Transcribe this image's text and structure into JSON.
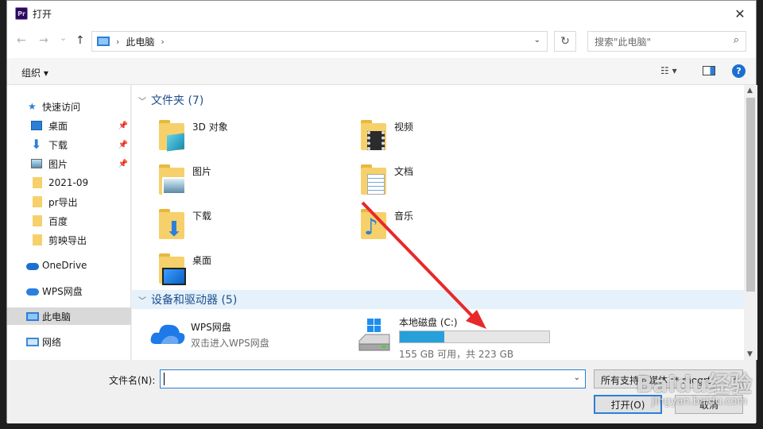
{
  "window": {
    "title": "打开",
    "app_icon": "Pr",
    "close": "✕"
  },
  "nav": {
    "back": "←",
    "forward": "→",
    "recent": "⌄",
    "up": "↑",
    "breadcrumb": [
      "此电脑"
    ],
    "refresh": "↻",
    "search_placeholder": "搜索\"此电脑\""
  },
  "toolbar": {
    "organize": "组织 ▾",
    "help": "?"
  },
  "sidebar": {
    "items": [
      {
        "label": "快速访问",
        "icon": "star-icon"
      },
      {
        "label": "桌面",
        "icon": "desktop-icon",
        "pinned": true
      },
      {
        "label": "下载",
        "icon": "download-icon",
        "pinned": true
      },
      {
        "label": "图片",
        "icon": "pictures-icon",
        "pinned": true
      },
      {
        "label": "2021-09",
        "icon": "folder-icon"
      },
      {
        "label": "pr导出",
        "icon": "folder-icon"
      },
      {
        "label": "百度",
        "icon": "folder-icon"
      },
      {
        "label": "剪映导出",
        "icon": "folder-icon"
      },
      {
        "label": "OneDrive",
        "icon": "cloud-icon"
      },
      {
        "label": "WPS网盘",
        "icon": "cloud-icon"
      },
      {
        "label": "此电脑",
        "icon": "computer-icon",
        "selected": true
      },
      {
        "label": "网络",
        "icon": "network-icon"
      }
    ]
  },
  "groups": {
    "folders_header": "文件夹 (7)",
    "devices_header": "设备和驱动器 (5)"
  },
  "folders": [
    {
      "name": "3D 对象",
      "icon": "3d-objects-icon"
    },
    {
      "name": "视频",
      "icon": "videos-icon"
    },
    {
      "name": "图片",
      "icon": "pictures-icon"
    },
    {
      "name": "文档",
      "icon": "documents-icon"
    },
    {
      "name": "下载",
      "icon": "download-icon"
    },
    {
      "name": "音乐",
      "icon": "music-icon"
    },
    {
      "name": "桌面",
      "icon": "desktop-icon"
    }
  ],
  "devices": [
    {
      "name": "WPS网盘",
      "sub": "双击进入WPS网盘",
      "icon": "wps-cloud-icon"
    },
    {
      "name": "本地磁盘 (C:)",
      "sub": "155 GB 可用，共 223 GB",
      "icon": "drive-icon",
      "used_fraction": 0.3
    }
  ],
  "bottom": {
    "filename_label": "文件名(N):",
    "filename_value": "",
    "filter_value": "所有支持的媒体 (*.mogrt",
    "open": "打开(O)",
    "cancel": "取消"
  },
  "watermark": {
    "text": "Baidu经验",
    "sub": "jingyan.baidu.com"
  },
  "colors": {
    "accent": "#2c7fd8",
    "arrow": "#e8282b",
    "drive_fill": "#26a0da"
  }
}
